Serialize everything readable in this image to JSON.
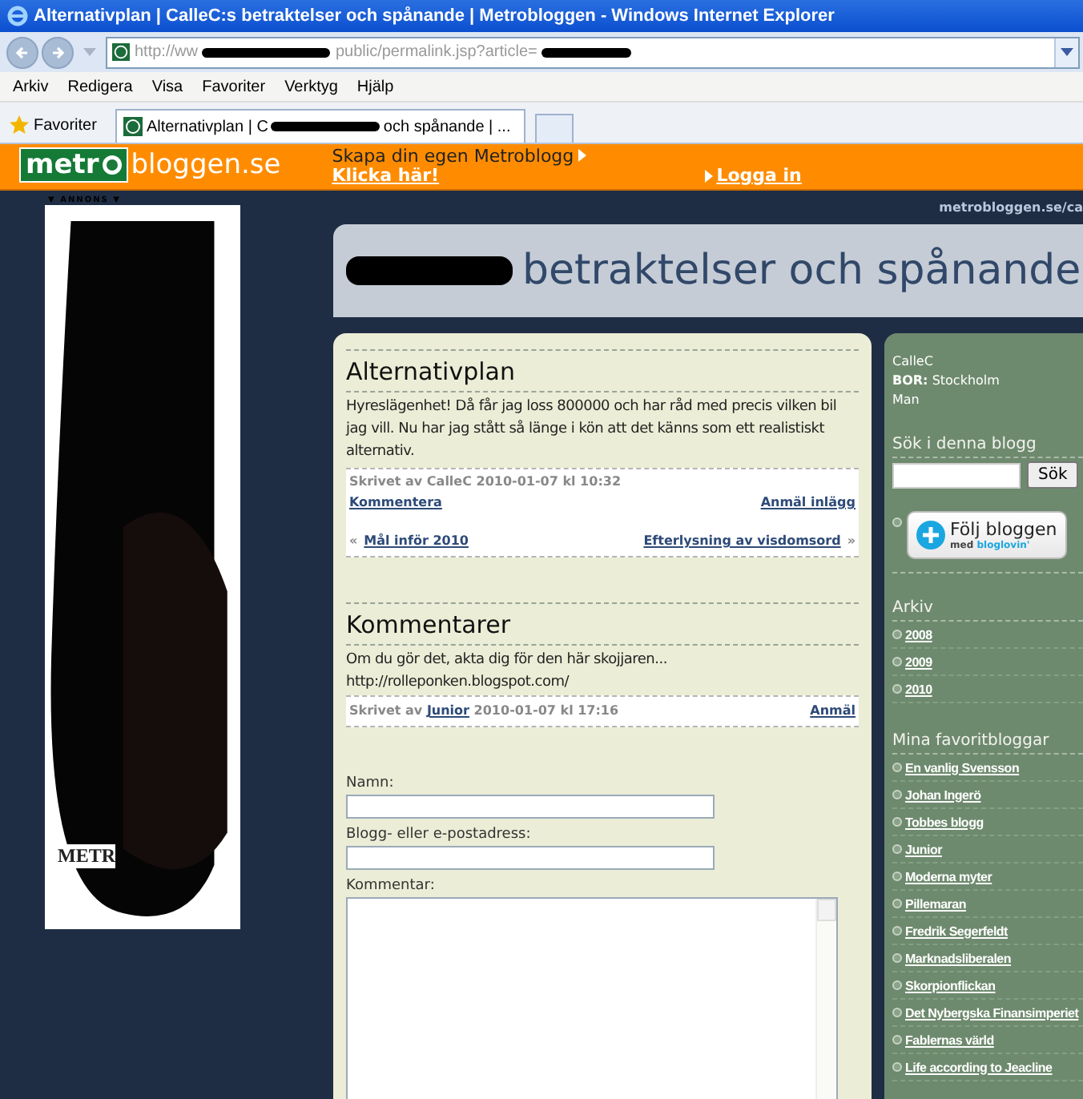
{
  "window": {
    "title": "Alternativplan | CalleC:s betraktelser och spånande | Metrobloggen - Windows Internet Explorer"
  },
  "address_bar": {
    "url_start": "http://ww",
    "url_middle": "public/permalink.jsp?article="
  },
  "menu": [
    "Arkiv",
    "Redigera",
    "Visa",
    "Favoriter",
    "Verktyg",
    "Hjälp"
  ],
  "favorites_button": "Favoriter",
  "tabs": [
    {
      "label_start": "Alternativplan | C",
      "label_end": "och spånande | ...",
      "selected": true
    }
  ],
  "site_header": {
    "logo_left": "metr",
    "logo_right": "bloggen.se",
    "promo": "Skapa din egen Metroblogg",
    "promo_link": "Klicka här!",
    "login": "Logga in"
  },
  "ad": {
    "label": "▼ ANNONS ▼",
    "visible_text": "METR"
  },
  "blog": {
    "domain": "metrobloggen.se/ca",
    "title": "betraktelser och spånande"
  },
  "post": {
    "title": "Alternativplan",
    "body": "Hyreslägenhet! Då får jag loss 800000 och har råd med precis vilken bil jag vill. Nu har jag stått så länge i kön att det känns som ett realistiskt alternativ.",
    "byline": "Skrivet av CalleC 2010-01-07 kl 10:32",
    "comment_link": "Kommentera",
    "report_link": "Anmäl inlägg",
    "prev_mark": "«",
    "prev": "Mål inför 2010",
    "next": "Efterlysning av visdomsord",
    "next_mark": "»"
  },
  "comments": {
    "heading": "Kommentarer",
    "items": [
      {
        "lines": [
          "Om du gör det, akta dig för den här skojjaren...",
          "http://rolleponken.blogspot.com/"
        ],
        "byline_prefix": "Skrivet av",
        "author": "Junior",
        "date": "2010-01-07 kl 17:16",
        "report": "Anmäl"
      }
    ]
  },
  "form": {
    "fields": [
      {
        "label": "Namn:",
        "kind": "input"
      },
      {
        "label": "Blogg- eller e-postadress:",
        "kind": "input"
      },
      {
        "label": "Kommentar:",
        "kind": "textarea"
      }
    ]
  },
  "sidebar": {
    "profile": {
      "name": "CalleC",
      "location_label": "BOR:",
      "location": "Stockholm",
      "gender": "Man"
    },
    "search": {
      "heading": "Sök i denna blogg",
      "button": "Sök"
    },
    "follow": {
      "title": "Följ bloggen",
      "sub_prefix": "med",
      "sub_brand": "bloglovin'"
    },
    "archive": {
      "heading": "Arkiv",
      "items": [
        "2008",
        "2009",
        "2010"
      ]
    },
    "favorites": {
      "heading": "Mina favoritbloggar",
      "items": [
        "En vanlig Svensson",
        "Johan Ingerö",
        "Tobbes blogg",
        "Junior",
        "Moderna myter",
        "Pillemaran",
        "Fredrik Segerfeldt",
        "Marknadsliberalen",
        "Skorpionflickan",
        "Det Nybergska Finansimperiet",
        "Fablernas värld",
        "Life according to Jeacline"
      ]
    }
  }
}
